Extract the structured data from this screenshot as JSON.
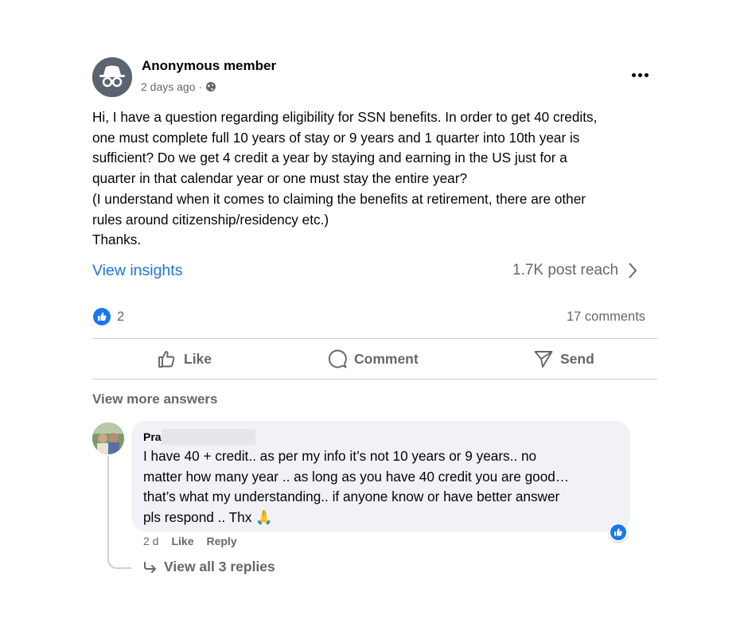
{
  "post": {
    "author": "Anonymous member",
    "time": "2 days ago",
    "separator": "·",
    "privacy_icon": "globe-icon",
    "more_icon": "more-horizontal-icon",
    "body_lines": [
      "Hi, I have a question regarding eligibility for SSN benefits. In order to get 40 credits,",
      "one must complete full 10 years of stay or 9 years and 1 quarter into 10th year is",
      "sufficient? Do we get 4 credit a year by staying and earning in the US just for a",
      "quarter in that calendar year or one must stay the entire year?",
      "(I understand when it comes to claiming the benefits at retirement, there are other",
      "rules around citizenship/residency etc.)",
      "Thanks."
    ]
  },
  "insights": {
    "link": "View insights",
    "reach": "1.7K post reach"
  },
  "reactions": {
    "count": "2",
    "comments": "17 comments"
  },
  "actions": {
    "like": "Like",
    "comment": "Comment",
    "send": "Send"
  },
  "comments_section": {
    "view_more": "View more answers",
    "comment": {
      "author": "Pra",
      "lines": [
        "I have 40 + credit.. as per my info it’s not 10 years or 9 years.. no",
        "matter how many year .. as long as you have 40 credit you are good…",
        "that’s what my understanding.. if anyone know or have better answer",
        "pls respond .. Thx 🙏"
      ],
      "time": "2 d",
      "like": "Like",
      "reply": "Reply",
      "view_replies": "View all 3 replies"
    }
  },
  "colors": {
    "accent": "#1b74e4",
    "like_blue": "#1877f2",
    "secondary_text": "#65676b",
    "bubble_bg": "#f0f2f5"
  }
}
